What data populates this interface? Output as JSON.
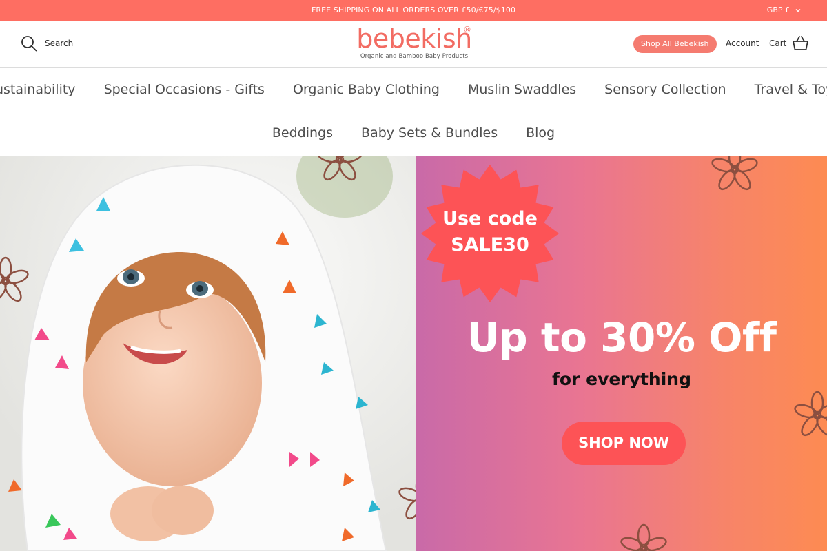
{
  "announcement": {
    "text": "FREE SHIPPING ON ALL ORDERS OVER £50/€75/$100",
    "currency": "GBP £"
  },
  "header": {
    "search_label": "Search",
    "logo_text": "bebekish",
    "logo_registered": "®",
    "logo_tagline": "Organic and Bamboo Baby Products",
    "shop_all_label": "Shop All Bebekish",
    "account_label": "Account",
    "cart_label": "Cart"
  },
  "nav": {
    "row1": [
      "Sustainability",
      "Special Occasions - Gifts",
      "Organic Baby Clothing",
      "Muslin Swaddles",
      "Sensory Collection",
      "Travel & Toys"
    ],
    "row2": [
      "Beddings",
      "Baby Sets & Bundles",
      "Blog"
    ]
  },
  "hero": {
    "code_line1": "Use code",
    "code_line2": "SALE30",
    "headline": "Up to 30% Off",
    "subline": "for everything",
    "cta_label": "SHOP NOW"
  },
  "colors": {
    "announcement_bg": "#fe6e62",
    "brand": "#f26c63",
    "shop_all_bg": "#f57b70",
    "cta_bg": "#fd5356",
    "burst": "#fd5356"
  },
  "icons": {
    "search": "search-icon",
    "cart": "basket-icon",
    "currency_dropdown": "chevron-down-icon"
  }
}
